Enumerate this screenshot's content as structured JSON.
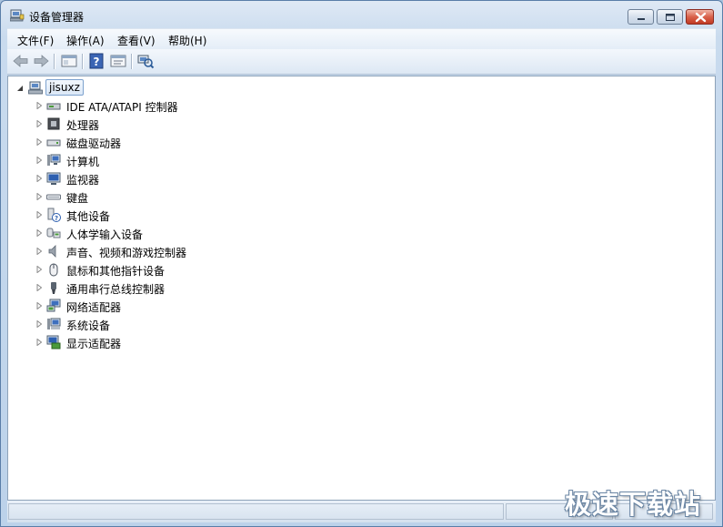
{
  "window": {
    "title": "设备管理器",
    "icon": "device-manager-icon"
  },
  "menu": {
    "items": [
      "文件(F)",
      "操作(A)",
      "查看(V)",
      "帮助(H)"
    ]
  },
  "toolbar": {
    "buttons": [
      "back-icon",
      "forward-icon",
      "show-hide-console-tree-icon",
      "help-icon",
      "properties-icon",
      "scan-hardware-icon"
    ]
  },
  "tree": {
    "root": "jisuxz",
    "children": [
      {
        "label": "IDE ATA/ATAPI 控制器",
        "icon": "ide-controller-icon"
      },
      {
        "label": "处理器",
        "icon": "processor-icon"
      },
      {
        "label": "磁盘驱动器",
        "icon": "disk-drive-icon"
      },
      {
        "label": "计算机",
        "icon": "computer-icon"
      },
      {
        "label": "监视器",
        "icon": "monitor-icon"
      },
      {
        "label": "键盘",
        "icon": "keyboard-icon"
      },
      {
        "label": "其他设备",
        "icon": "unknown-device-icon"
      },
      {
        "label": "人体学输入设备",
        "icon": "hid-icon"
      },
      {
        "label": "声音、视频和游戏控制器",
        "icon": "sound-icon"
      },
      {
        "label": "鼠标和其他指针设备",
        "icon": "mouse-icon"
      },
      {
        "label": "通用串行总线控制器",
        "icon": "usb-icon"
      },
      {
        "label": "网络适配器",
        "icon": "network-adapter-icon"
      },
      {
        "label": "系统设备",
        "icon": "system-device-icon"
      },
      {
        "label": "显示适配器",
        "icon": "display-adapter-icon"
      }
    ]
  },
  "watermark": "极速下载站",
  "colors": {
    "accent": "#3c7fb1",
    "close": "#c13b24"
  }
}
